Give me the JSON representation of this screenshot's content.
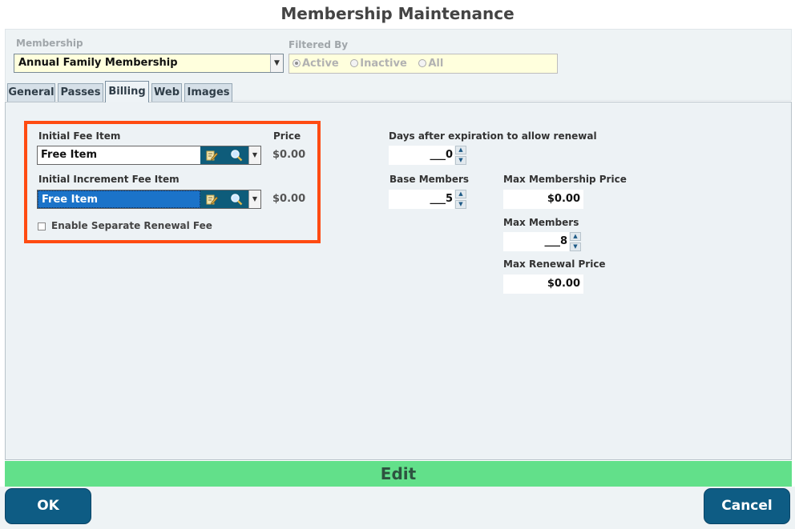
{
  "window": {
    "title": "Membership Maintenance"
  },
  "membership": {
    "label": "Membership",
    "selected": "Annual Family Membership"
  },
  "filter": {
    "label": "Filtered By",
    "options": [
      "Active",
      "Inactive",
      "All"
    ],
    "selected": "Active"
  },
  "tabs": [
    {
      "label": "General"
    },
    {
      "label": "Passes"
    },
    {
      "label": "Billing",
      "active": true
    },
    {
      "label": "Web"
    },
    {
      "label": "Images"
    }
  ],
  "billing": {
    "initial_fee": {
      "label": "Initial Fee Item",
      "value": "Free Item",
      "price": "$0.00"
    },
    "price_header": "Price",
    "increment_fee": {
      "label": "Initial Increment Fee Item",
      "value": "Free Item",
      "price": "$0.00"
    },
    "renewal_checkbox": {
      "label": "Enable Separate Renewal Fee",
      "checked": false
    },
    "days_after_expiration": {
      "label": "Days after expiration to allow renewal",
      "value": "___0"
    },
    "base_members": {
      "label": "Base Members",
      "value": "___5"
    },
    "max_membership_price": {
      "label": "Max Membership Price",
      "value": "$0.00"
    },
    "max_members": {
      "label": "Max Members",
      "value": "___8"
    },
    "max_renewal_price": {
      "label": "Max Renewal Price",
      "value": "$0.00"
    }
  },
  "mode_bar": {
    "label": "Edit"
  },
  "buttons": {
    "ok": "OK",
    "cancel": "Cancel"
  },
  "colors": {
    "accent_button": "#0e5c84",
    "edit_bar": "#62e08a",
    "highlight_box": "#ff4b12",
    "selected_field": "#1b73c9",
    "input_background": "#ffffdd"
  }
}
